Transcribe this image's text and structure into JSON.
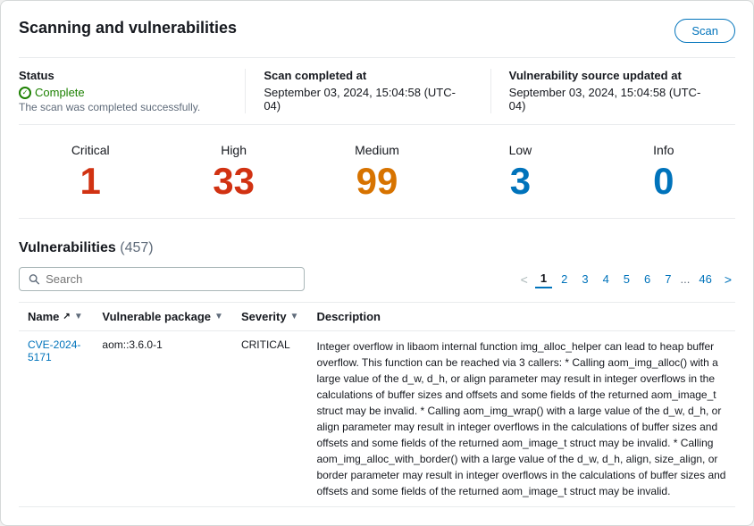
{
  "page": {
    "title": "Scanning and vulnerabilities",
    "scan_button": "Scan"
  },
  "status": {
    "label": "Status",
    "value": "Complete",
    "subtitle": "The scan was completed successfully.",
    "scan_label": "Scan completed at",
    "scan_value": "September 03, 2024, 15:04:58 (UTC-04)",
    "vuln_label": "Vulnerability source updated at",
    "vuln_value": "September 03, 2024, 15:04:58 (UTC-04)"
  },
  "metrics": [
    {
      "label": "Critical",
      "value": "1",
      "class": "critical"
    },
    {
      "label": "High",
      "value": "33",
      "class": "high"
    },
    {
      "label": "Medium",
      "value": "99",
      "class": "medium"
    },
    {
      "label": "Low",
      "value": "3",
      "class": "low"
    },
    {
      "label": "Info",
      "value": "0",
      "class": "info"
    }
  ],
  "vulnerabilities": {
    "title": "Vulnerabilities",
    "count": "(457)",
    "search_placeholder": "Search",
    "pagination": {
      "prev": "<",
      "next": ">",
      "pages": [
        "1",
        "2",
        "3",
        "4",
        "5",
        "6",
        "7",
        "...",
        "46"
      ],
      "active": "1"
    },
    "columns": [
      {
        "label": "Name",
        "icon": "↗",
        "sort": true
      },
      {
        "label": "Vulnerable package",
        "sort": true
      },
      {
        "label": "Severity",
        "sort": true
      },
      {
        "label": "Description",
        "sort": false
      }
    ],
    "rows": [
      {
        "name": "CVE-2024-5171",
        "package": "aom::3.6.0-1",
        "severity": "CRITICAL",
        "description": "Integer overflow in libaom internal function img_alloc_helper can lead to heap buffer overflow. This function can be reached via 3 callers: * Calling aom_img_alloc() with a large value of the d_w, d_h, or align parameter may result in integer overflows in the calculations of buffer sizes and offsets and some fields of the returned aom_image_t struct may be invalid. * Calling aom_img_wrap() with a large value of the d_w, d_h, or align parameter may result in integer overflows in the calculations of buffer sizes and offsets and some fields of the returned aom_image_t struct may be invalid. * Calling aom_img_alloc_with_border() with a large value of the d_w, d_h, align, size_align, or border parameter may result in integer overflows in the calculations of buffer sizes and offsets and some fields of the returned aom_image_t struct may be invalid."
      }
    ]
  }
}
